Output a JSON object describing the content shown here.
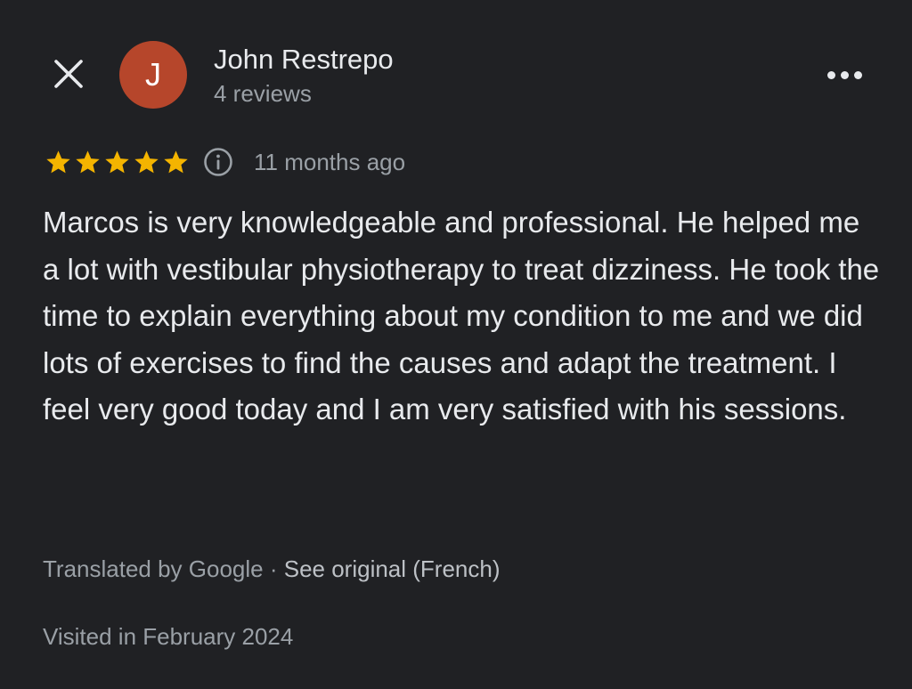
{
  "colors": {
    "background": "#202124",
    "avatar_bg": "#b6462b",
    "star": "#f4b400",
    "primary_text": "#e8eaed",
    "secondary_text": "#9aa0a6"
  },
  "header": {
    "close_icon": "close-icon",
    "more_icon": "more-horizontal-icon"
  },
  "author": {
    "initial": "J",
    "name": "John Restrepo",
    "reviews": "4 reviews"
  },
  "review": {
    "rating": 5,
    "rating_max": 5,
    "time_ago": "11 months ago",
    "text": "Marcos is very knowledgeable and professional. He helped me a lot with vestibular physiotherapy to treat dizziness. He took the time to explain everything about my condition to me and we did lots of exercises to find the causes and adapt the treatment. I feel very good today and I am very satisfied with his sessions."
  },
  "translation": {
    "label": "Translated by Google",
    "separator": " · ",
    "see_original": "See original (French)"
  },
  "visited": "Visited in February 2024"
}
